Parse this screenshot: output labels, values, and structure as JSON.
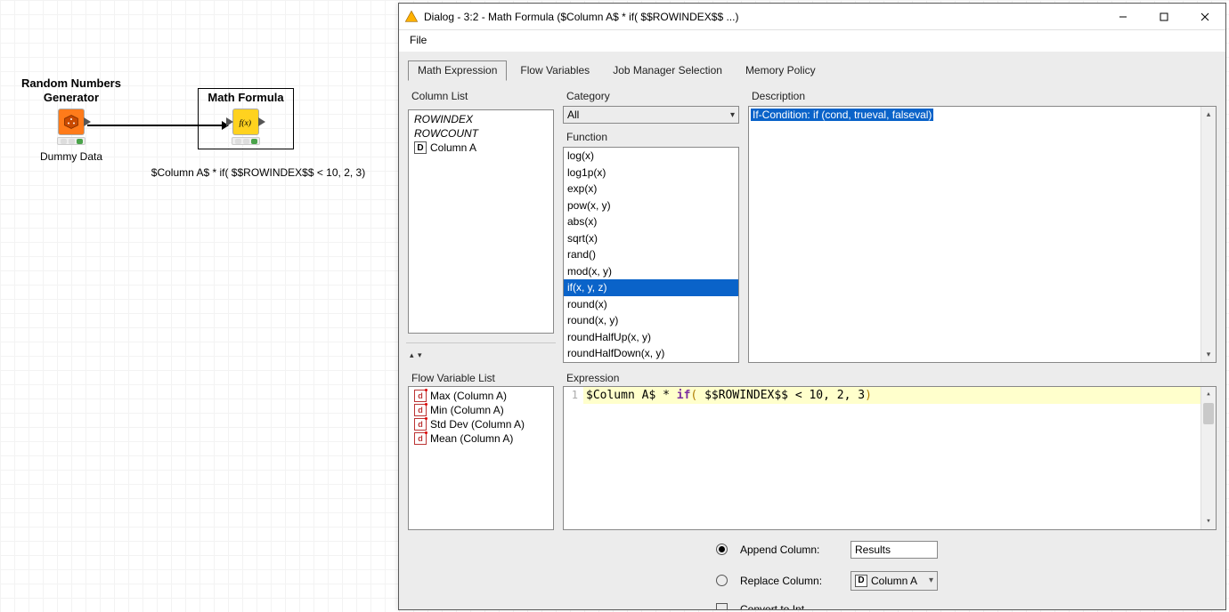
{
  "canvas": {
    "node1": {
      "title_l1": "Random Numbers",
      "title_l2": "Generator",
      "label": "Dummy Data"
    },
    "node2": {
      "title": "Math Formula",
      "label": "$Column A$ * if( $$ROWINDEX$$ < 10, 2, 3)"
    }
  },
  "dialog": {
    "title": "Dialog - 3:2 - Math Formula ($Column A$ * if( $$ROWINDEX$$ ...)",
    "menu": {
      "file": "File"
    },
    "tabs": {
      "math": "Math Expression",
      "flow": "Flow Variables",
      "job": "Job Manager Selection",
      "mem": "Memory Policy"
    },
    "labels": {
      "column_list": "Column List",
      "category": "Category",
      "function": "Function",
      "description": "Description",
      "flow_var_list": "Flow Variable List",
      "expression": "Expression",
      "append": "Append Column:",
      "replace": "Replace Column:",
      "convert": "Convert to Int"
    },
    "column_list": {
      "rowindex": "ROWINDEX",
      "rowcount": "ROWCOUNT",
      "col_a": "Column A"
    },
    "category_value": "All",
    "functions": [
      "log(x)",
      "log1p(x)",
      "exp(x)",
      "pow(x, y)",
      "abs(x)",
      "sqrt(x)",
      "rand()",
      "mod(x, y)",
      "if(x, y, z)",
      "round(x)",
      "round(x, y)",
      "roundHalfUp(x, y)",
      "roundHalfDown(x, y)"
    ],
    "function_selected": "if(x, y, z)",
    "description_text": "If-Condition: if (cond, trueval, falseval)",
    "flow_vars": [
      "Max (Column A)",
      "Min (Column A)",
      "Std Dev (Column A)",
      "Mean (Column A)"
    ],
    "expression": {
      "col": "$Column A$",
      "star": " * ",
      "kw": "if",
      "lpar": "(",
      "body": " $$ROWINDEX$$ < 10, 2, 3",
      "rpar": ")"
    },
    "append_value": "Results",
    "replace_value": "Column A"
  }
}
